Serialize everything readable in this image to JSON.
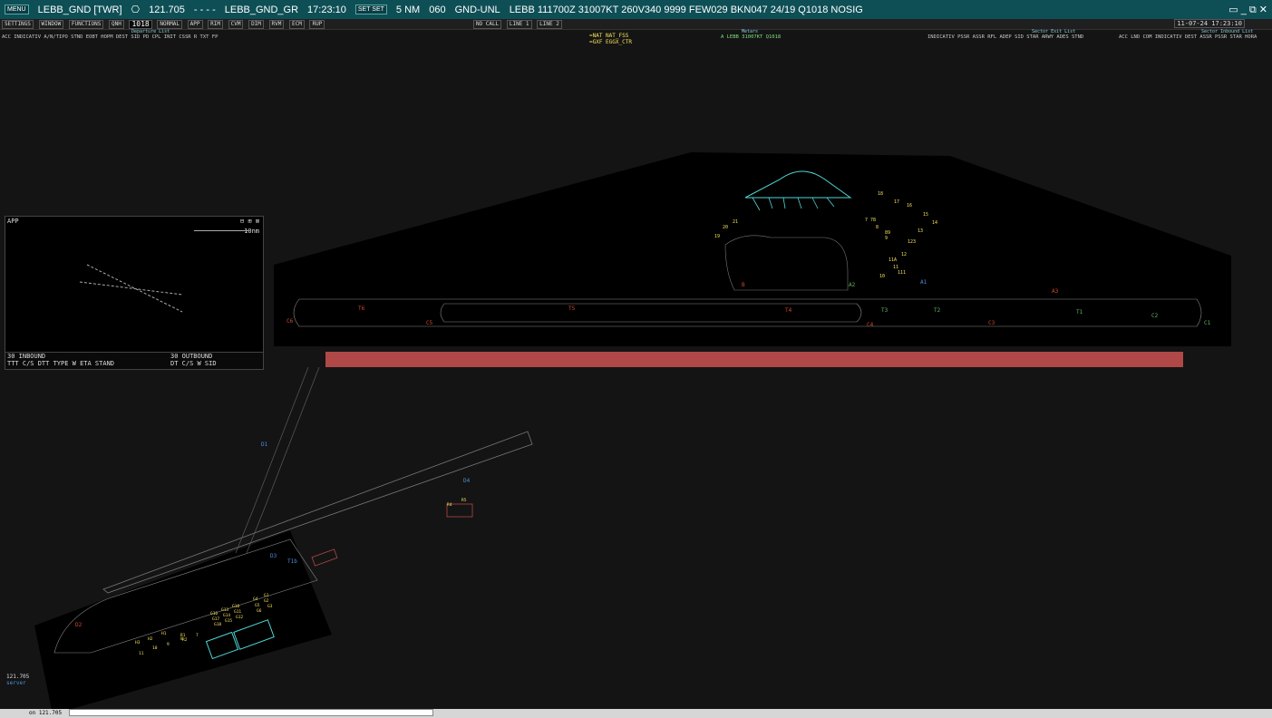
{
  "topbar": {
    "position": "LEBB_GND [TWR]",
    "freq": "121.705",
    "callsign": "LEBB_GND_GR",
    "time": "17:23:10",
    "range": "5 NM",
    "alt": "060",
    "status": "GND-UNL",
    "metar": "LEBB 111700Z 31007KT 260V340 9999 FEW029 BKN047 24/19 Q1018 NOSIG"
  },
  "menu": {
    "settings": "SETTINGS",
    "window": "WINDOW",
    "functions": "FUNCTIONS",
    "qnh_label": "QNH",
    "qnh_value": "1018",
    "mode": "NORMAL",
    "buttons": [
      "APP",
      "RIM",
      "CVM",
      "DIM",
      "RVM",
      "ECM",
      "RUP"
    ],
    "no_call": "NO CALL",
    "line1": "LINE 1",
    "line2": "LINE 2",
    "date": "11-07-24 17:23:10"
  },
  "departure_list": {
    "title": "Departure List",
    "columns": "ACC INDICATIV A/N/TIPO STND EOBT HOPM DEST   SID   PD  CPL  INIT CSSR R    TXT    FP"
  },
  "atc_list": {
    "items": [
      "=NAT NAT_FSS",
      "=GXF EGGX_CTR"
    ]
  },
  "metars": {
    "title": "Metars",
    "value": "A LEBB 31007KT Q1018"
  },
  "sector_exit": {
    "title": "Sector Exit List",
    "columns": "INDICATIV PSSR ASSR  RFL  ADEP   SID    STAR  ARWY ADES STND"
  },
  "sector_inbound": {
    "title": "Sector Inbound List",
    "columns": "ACC  LND COM INDICATIV DEST  ASSR PSSR   STAR  HORA"
  },
  "app_window": {
    "title": "APP",
    "scale": "10nm"
  },
  "inbound": {
    "title": "30 INBOUND",
    "columns": "TTT  C/S       DTT TYPE W ETA  STAND"
  },
  "outbound": {
    "title": "30 OUTBOUND",
    "columns": "DT   C/S        W SID"
  },
  "bottom": {
    "freq": "121.705",
    "server": "server",
    "status": "on 121.705"
  },
  "map_labels": {
    "taxiways": [
      "C6",
      "T6",
      "C5",
      "T5",
      "T4",
      "C4",
      "T3",
      "T2",
      "C3",
      "T1",
      "C2",
      "C1",
      "B",
      "A2",
      "A1",
      "A3",
      "D1",
      "D2",
      "D3",
      "D4",
      "T1b"
    ],
    "stands_north": [
      "18",
      "17",
      "16",
      "15",
      "14",
      "13",
      "123",
      "12",
      "11A",
      "11",
      "111",
      "10",
      "9",
      "8",
      "7",
      "78",
      "89",
      "19",
      "20",
      "21"
    ],
    "stands_south": [
      "G1",
      "G2",
      "G3",
      "G4",
      "G5",
      "G6",
      "G10",
      "G11",
      "G12",
      "G13",
      "G14",
      "G15",
      "G16",
      "G17",
      "G18",
      "H1",
      "H2",
      "H3",
      "11",
      "10",
      "9",
      "8",
      "7",
      "R1",
      "R2"
    ],
    "remote": [
      "R4",
      "R5"
    ]
  },
  "colors": {
    "runway": "#b04848",
    "topbar": "#0e4f56",
    "stand_text": "#f3e05a",
    "taxi_red": "#d04a2a",
    "taxi_green": "#5fb85f",
    "taxi_blue": "#4a8fd6",
    "terminal": "#4fd6d6"
  }
}
